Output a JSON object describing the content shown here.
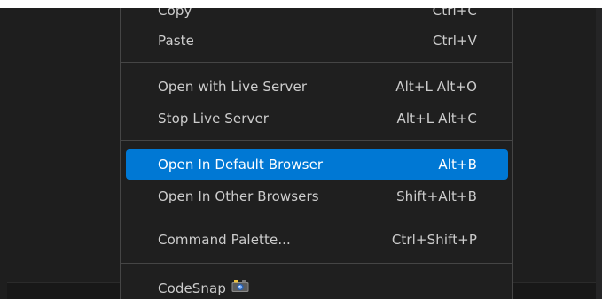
{
  "menu": {
    "items": [
      {
        "label": "Copy",
        "shortcut": "Ctrl+C"
      },
      {
        "label": "Paste",
        "shortcut": "Ctrl+V"
      },
      {
        "label": "Open with Live Server",
        "shortcut": "Alt+L Alt+O"
      },
      {
        "label": "Stop Live Server",
        "shortcut": "Alt+L Alt+C"
      },
      {
        "label": "Open In Default Browser",
        "shortcut": "Alt+B",
        "state": "highlighted"
      },
      {
        "label": "Open In Other Browsers",
        "shortcut": "Shift+Alt+B"
      },
      {
        "label": "Command Palette...",
        "shortcut": "Ctrl+Shift+P"
      },
      {
        "label": "CodeSnap",
        "shortcut": "",
        "icon": "camera-icon"
      }
    ]
  },
  "colors": {
    "highlight": "#0078d4",
    "menu_background": "#1f1f1f",
    "text": "#cccccc",
    "separator": "#454545"
  }
}
